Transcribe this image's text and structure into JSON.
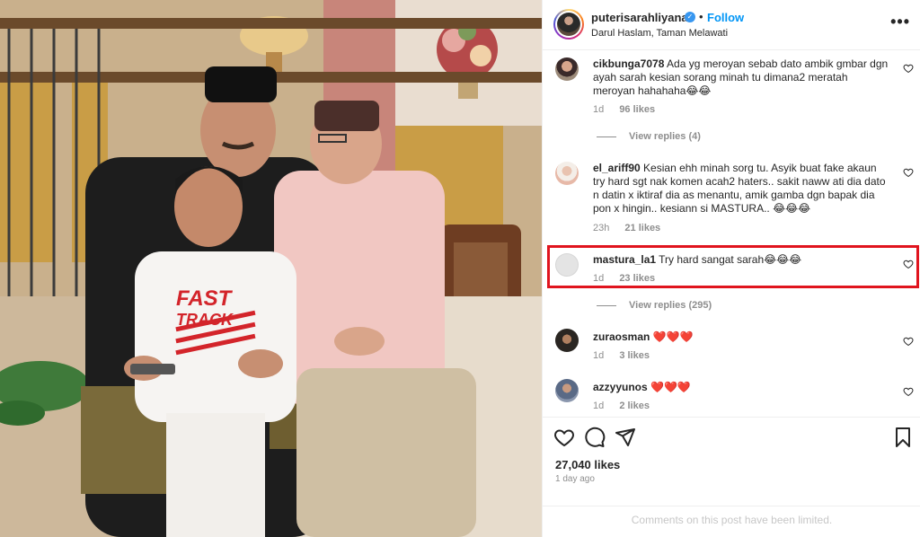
{
  "post": {
    "username": "puterisarahliyana",
    "separator": "•",
    "follow_label": "Follow",
    "location": "Darul Haslam, Taman Melawati",
    "more_label": "•••"
  },
  "photo": {
    "shirt_text_1": "FAST",
    "shirt_text_2": "TRACK"
  },
  "comments": [
    {
      "username": "cikbunga7078",
      "text": "Ada yg meroyan sebab dato ambik gmbar dgn ayah sarah kesian sorang minah tu dimana2 meratah meroyan hahahaha😂😂",
      "time": "1d",
      "likes": "96 likes",
      "replies": "View replies (4)"
    },
    {
      "username": "el_ariff90",
      "text": "Kesian ehh minah sorg tu. Asyik buat fake akaun try hard sgt nak komen acah2 haters.. sakit naww ati dia dato n datin x iktiraf dia as menantu, amik gamba dgn bapak dia pon x hingin.. kesiann si MASTURA.. 😂😂😂",
      "time": "23h",
      "likes": "21 likes"
    },
    {
      "username": "mastura_la1",
      "text": "Try hard sangat sarah😂😂😂",
      "time": "1d",
      "likes": "23 likes",
      "replies": "View replies (295)"
    },
    {
      "username": "zuraosman",
      "text": "❤️❤️❤️",
      "time": "1d",
      "likes": "3 likes"
    },
    {
      "username": "azzyyunos",
      "text": "❤️❤️❤️",
      "time": "1d",
      "likes": "2 likes"
    }
  ],
  "footer": {
    "likes": "27,040 likes",
    "date": "1 day ago",
    "limited": "Comments on this post have been limited."
  },
  "icons": {
    "heart": "heart-icon",
    "comment": "comment-icon",
    "share": "share-icon",
    "save": "bookmark-icon"
  },
  "colors": {
    "follow": "#0095f6",
    "highlight_border": "#e0141e",
    "meta_text": "#8e8e8e"
  }
}
